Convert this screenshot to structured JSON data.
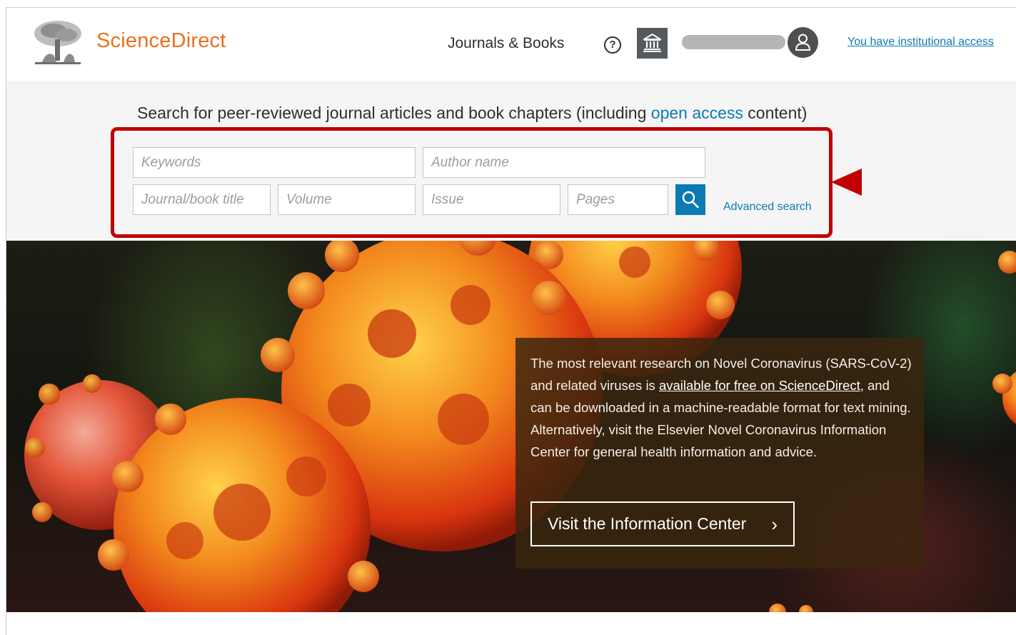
{
  "header": {
    "brand": "ScienceDirect",
    "nav_journals": "Journals & Books",
    "help_icon_glyph": "?",
    "institution_icon": "institution-icon",
    "user_icon": "user-avatar-icon",
    "institutional_access": "You have institutional access"
  },
  "search": {
    "heading_prefix": "Search for peer-reviewed journal articles and book chapters (including ",
    "heading_link": "open access",
    "heading_suffix": " content)",
    "keywords_placeholder": "Keywords",
    "author_placeholder": "Author name",
    "journal_placeholder": "Journal/book title",
    "volume_placeholder": "Volume",
    "issue_placeholder": "Issue",
    "pages_placeholder": "Pages",
    "search_icon": "search-icon",
    "advanced_search": "Advanced search"
  },
  "hero": {
    "text_1": "The most relevant research on Novel Coronavirus (SARS-CoV-2) and related viruses is ",
    "text_link": "available for free on ScienceDirect",
    "text_2": ", and can be downloaded in a machine-readable format for text mining.",
    "text_3": "Alternatively, visit the Elsevier Novel Coronavirus Information Center for general health information and advice.",
    "button_label": "Visit the Information Center",
    "button_chevron": "›"
  },
  "colors": {
    "brand_orange": "#e9711c",
    "link_blue": "#0c7bb3",
    "annotation_red": "#c00000"
  }
}
